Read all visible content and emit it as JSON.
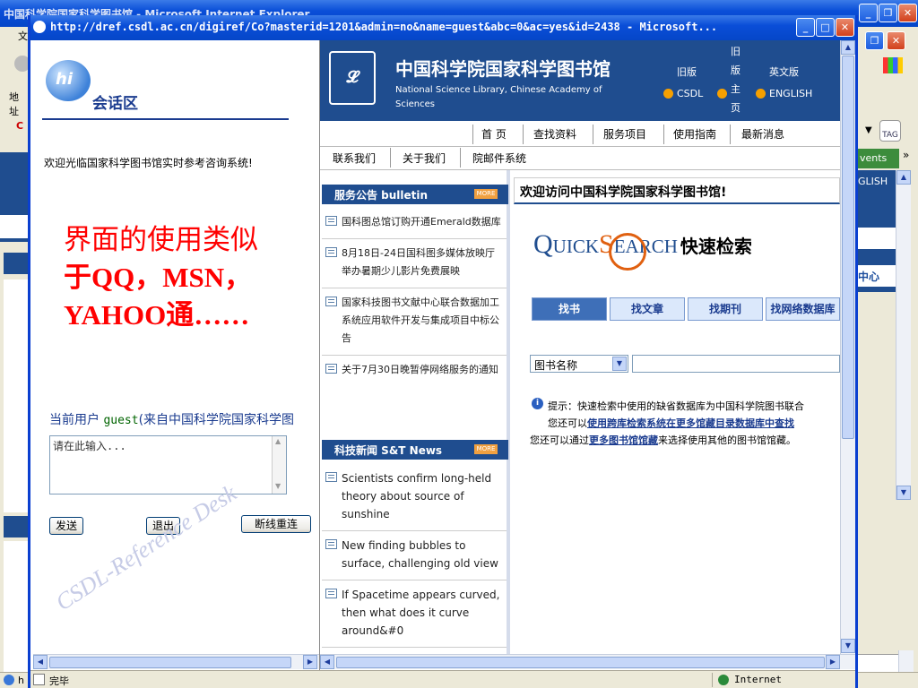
{
  "background_window": {
    "title": "中国科学院国家科学图书馆 - Microsoft Internet Explorer",
    "menu_first": "文",
    "address_label": "地址",
    "status": "完毕",
    "zone": "Internet",
    "tag_label": "TAG",
    "events_label": "vents",
    "english_fragment": "GLISH",
    "center_fragment": "中心"
  },
  "popup": {
    "title": "http://dref.csdl.ac.cn/digiref/Co?masterid=1201&admin=no&name=guest&abc=0&ac=yes&id=2438 - Microsoft..."
  },
  "chat": {
    "zone_title": "会话区",
    "welcome": "欢迎光临国家科学图书馆实时参考咨询系统!",
    "annotation_line1": "界面的使用类似",
    "annotation_line2": "于QQ，MSN，",
    "annotation_line3": "YAHOO通……",
    "current_user_label": "当前用户",
    "current_user_name": "guest",
    "current_user_from": "(来自中国科学院国家科学图",
    "input_placeholder": "请在此输入...",
    "send_button": "发送",
    "exit_button": "退出",
    "reconnect_button": "断线重连",
    "watermark": "CSDL-Reference Desk"
  },
  "library": {
    "logo_cn": "中国科学院国家科学图书馆",
    "logo_en": "National Science Library, Chinese Academy of Sciences",
    "old_csdl_1": "旧版",
    "old_csdl_2": "CSDL",
    "old_home_1": "旧",
    "old_home_2": "版",
    "old_home_3": "主",
    "old_home_4": "页",
    "english_1": "英文版",
    "english_2": "ENGLISH",
    "nav_row1": [
      "首  页",
      "查找资料",
      "服务项目",
      "使用指南",
      "最新消息"
    ],
    "nav_row2": [
      "联系我们",
      "关于我们",
      "院邮件系统"
    ],
    "bulletin_title": "服务公告  bulletin",
    "more": "MORE",
    "bulletin_items": [
      "国科图总馆订购开通Emerald数据库",
      "8月18日-24日国科图多媒体放映厅举办暑期少儿影片免费展映",
      "国家科技图书文献中心联合数据加工系统应用软件开发与集成项目中标公告",
      "关于7月30日晚暂停网络服务的通知"
    ],
    "news_title": "科技新闻  S&T News",
    "news_items": [
      "Scientists confirm long-held theory about source of sunshine",
      "New finding bubbles to surface, challenging old view",
      "If Spacetime appears curved, then what does it curve around&#0"
    ],
    "welcome": "欢迎访问中国科学院国家科学图书馆!",
    "quick_q": "Q",
    "quick_uick": "UICK",
    "quick_s": "S",
    "quick_earch": "EARCH",
    "quick_cn": "快速检索",
    "tabs": [
      "找书",
      "找文章",
      "找期刊",
      "找网络数据库"
    ],
    "select_value": "图书名称",
    "tip_line1": "提示：快速检索中使用的缺省数据库为中国科学院图书联合",
    "tip_line2_prefix": "您还可以",
    "tip_line2_link": "使用跨库检索系统在更多馆藏目录数据库中查找",
    "tip_line3_prefix": "您还可以通过",
    "tip_line3_link": "更多图书馆馆藏",
    "tip_line3_suffix": "来选择使用其他的图书馆馆藏。"
  },
  "colors": {
    "xp_title_blue": "#0a4ed8",
    "annotation_red": "#ff0000",
    "library_header_blue": "#1f4d8f",
    "tab_active": "#3e6fb8"
  }
}
